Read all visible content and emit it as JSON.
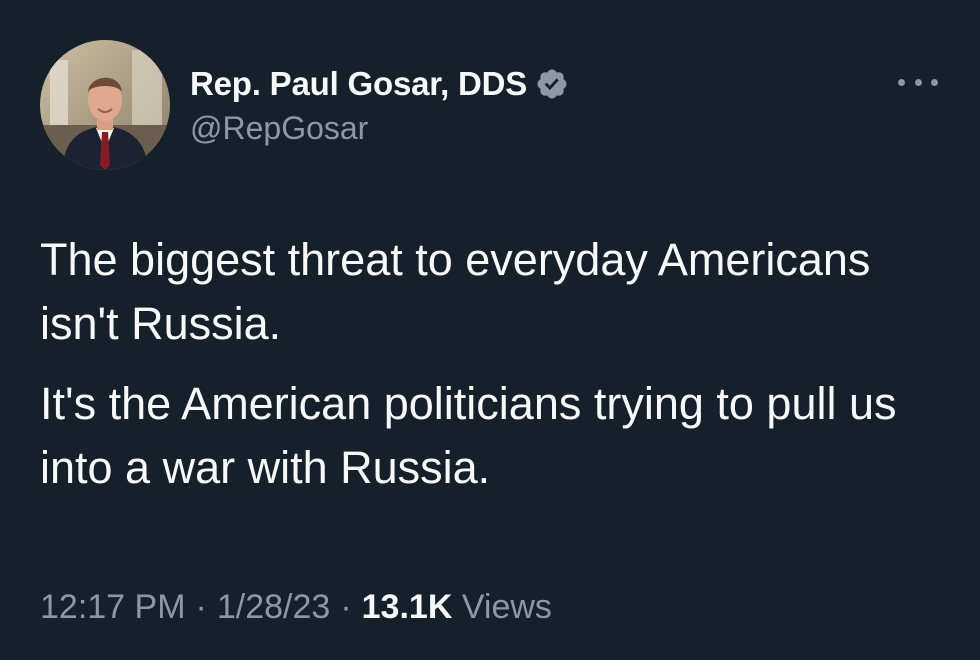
{
  "author": {
    "display_name": "Rep. Paul Gosar, DDS",
    "handle": "@RepGosar",
    "verified": true
  },
  "tweet": {
    "paragraphs": [
      "The biggest threat to everyday Americans isn't Russia.",
      "It's the American politicians trying to pull us into a war with Russia."
    ],
    "time": "12:17 PM",
    "date": "1/28/23",
    "separator": "·",
    "views_count": "13.1K",
    "views_label": "Views"
  },
  "colors": {
    "background": "#15202b",
    "text_primary": "#f7f9f9",
    "text_secondary": "#8b98a5",
    "verified_badge": "#8b98a5"
  },
  "icons": {
    "verified": "verified-badge-icon",
    "more": "more-options-icon"
  }
}
